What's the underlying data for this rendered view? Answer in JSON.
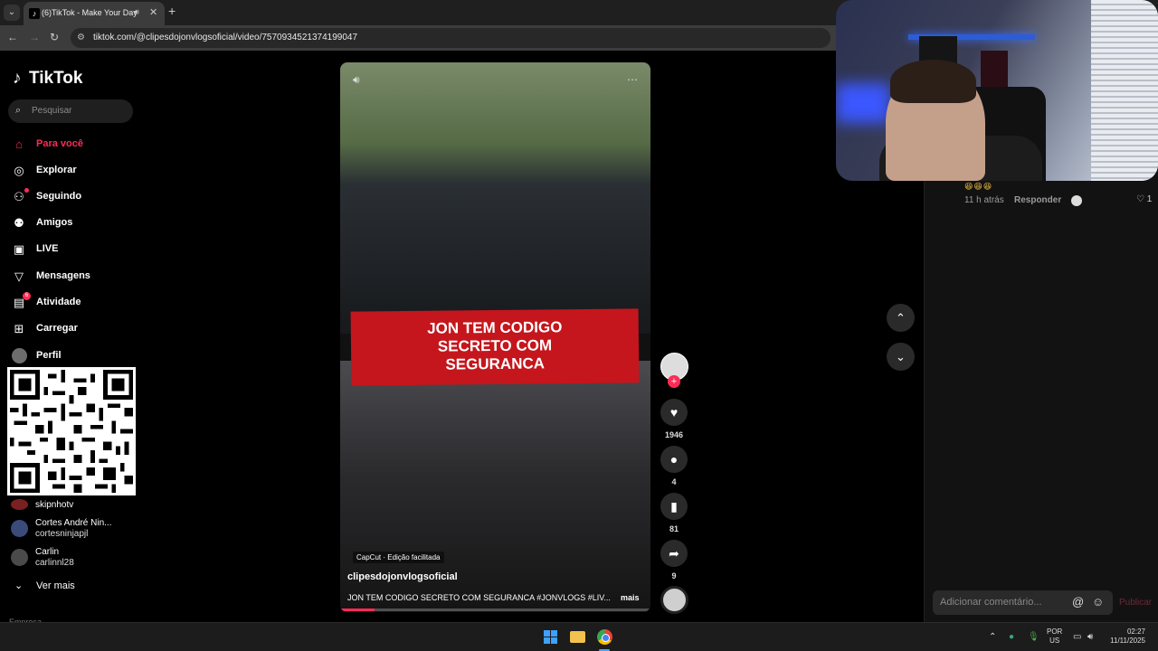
{
  "browser": {
    "tab_title": "(6)TikTok - Make Your Day",
    "url": "tiktok.com/@clipesdojonvlogsoficial/video/7570934521374199047"
  },
  "sidebar": {
    "logo": "TikTok",
    "search_placeholder": "Pesquisar",
    "nav": [
      {
        "label": "Para você",
        "icon": "home-icon",
        "active": true
      },
      {
        "label": "Explorar",
        "icon": "compass-icon"
      },
      {
        "label": "Seguindo",
        "icon": "following-icon"
      },
      {
        "label": "Amigos",
        "icon": "friends-icon"
      },
      {
        "label": "LIVE",
        "icon": "live-icon"
      },
      {
        "label": "Mensagens",
        "icon": "messages-icon"
      },
      {
        "label": "Atividade",
        "icon": "activity-icon",
        "badge": "6"
      },
      {
        "label": "Carregar",
        "icon": "upload-icon"
      },
      {
        "label": "Perfil",
        "icon": "profile-avatar"
      }
    ],
    "following": [
      {
        "name": "skipnhotv"
      },
      {
        "name": "Cortes André Nin...",
        "id": "cortesninjapjl"
      },
      {
        "name": "Carlin",
        "id": "carlinnl28"
      }
    ],
    "more_label": "Ver mais",
    "footer_partial": "Empresa"
  },
  "video": {
    "banner_lines": [
      "JON TEM CODIGO",
      "SECRETO COM",
      "SEGURANCA"
    ],
    "capcut_label": "CapCut · Edição facilitada",
    "username": "clipesdojonvlogsoficial",
    "caption": "JON TEM CODIGO SECRETO COM SEGURANCA #JONVLOGS #LIV...",
    "more_label": "mais",
    "progress": 0.11
  },
  "actions": {
    "likes": "1946",
    "comments": "4",
    "saves": "81",
    "shares": "9"
  },
  "comments_panel": {
    "emoji": "😆😆😆",
    "time": "11 h atrás",
    "reply_label": "Responder",
    "likes": "1",
    "input_placeholder": "Adicionar comentário...",
    "publish_label": "Publicar"
  },
  "taskbar": {
    "lang_top": "POR",
    "lang_bottom": "US",
    "time": "02:27",
    "date": "11/11/2025"
  }
}
